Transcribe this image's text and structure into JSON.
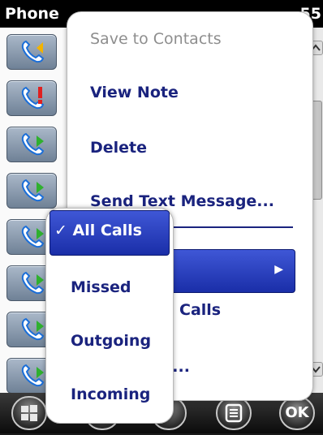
{
  "status_bar": {
    "app_title": "Phone",
    "time_fragment": "55"
  },
  "call_rows": [
    {
      "icon": "phone-outgoing-icon"
    },
    {
      "icon": "phone-missed-icon"
    },
    {
      "icon": "phone-incoming-icon"
    },
    {
      "icon": "phone-incoming-icon"
    },
    {
      "icon": "phone-incoming-icon"
    },
    {
      "icon": "phone-incoming-icon"
    },
    {
      "icon": "phone-incoming-icon"
    },
    {
      "icon": "phone-incoming-icon"
    }
  ],
  "context_menu": {
    "save_to_contacts": "Save to Contacts",
    "view_note": "View Note",
    "delete": "Delete",
    "send_text_message": "Send Text Message...",
    "partial_calls": "Calls",
    "partial_ellipsis": "s..."
  },
  "filter_submenu": {
    "all_calls": "All Calls",
    "missed": "Missed",
    "outgoing": "Outgoing",
    "incoming": "Incoming",
    "checkmark": "✓"
  },
  "menu_bar": {
    "ok_label": "OK"
  },
  "colors": {
    "menu_text": "#1a237e",
    "highlight": "#2a3fc0",
    "disabled_text": "#8e8e8e"
  }
}
